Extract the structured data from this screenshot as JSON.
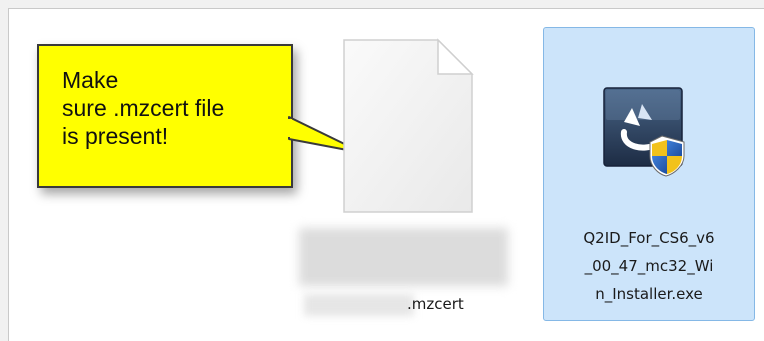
{
  "callout": {
    "text": "Make\nsure .mzcert file\nis present!"
  },
  "files": {
    "mzcert": {
      "name": ".mzcert",
      "icon": "blank-document-icon"
    },
    "installer": {
      "name": "Q2ID_For_CS6_v6\n_00_47_mc32_Wi\nn_Installer.exe",
      "icon": "installer-shield-icon",
      "selected": true
    }
  },
  "colors": {
    "callout_bg": "#ffff00",
    "selection_bg": "#cce4fa",
    "selection_border": "#85b8e6"
  }
}
